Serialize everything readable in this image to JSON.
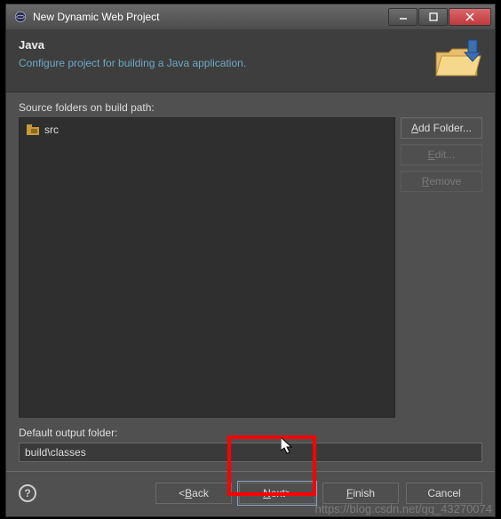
{
  "titlebar": {
    "title": "New Dynamic Web Project"
  },
  "header": {
    "title": "Java",
    "subtitle": "Configure project for building a Java application."
  },
  "labels": {
    "source_folders": "Source folders on build path:",
    "default_output": "Default output folder:"
  },
  "tree": {
    "items": [
      {
        "label": "src"
      }
    ]
  },
  "side": {
    "add_folder": "Add Folder...",
    "edit": "Edit...",
    "remove": "Remove"
  },
  "output_folder": {
    "value": "build\\classes"
  },
  "footer": {
    "back": "< Back",
    "next": "Next >",
    "finish": "Finish",
    "cancel": "Cancel"
  },
  "mnemonics": {
    "add_folder_u": "A",
    "edit_u": "E",
    "remove_u": "R",
    "back_u": "B",
    "next_u": "N",
    "finish_u": "F"
  },
  "watermark": "https://blog.csdn.net/qq_43270074"
}
